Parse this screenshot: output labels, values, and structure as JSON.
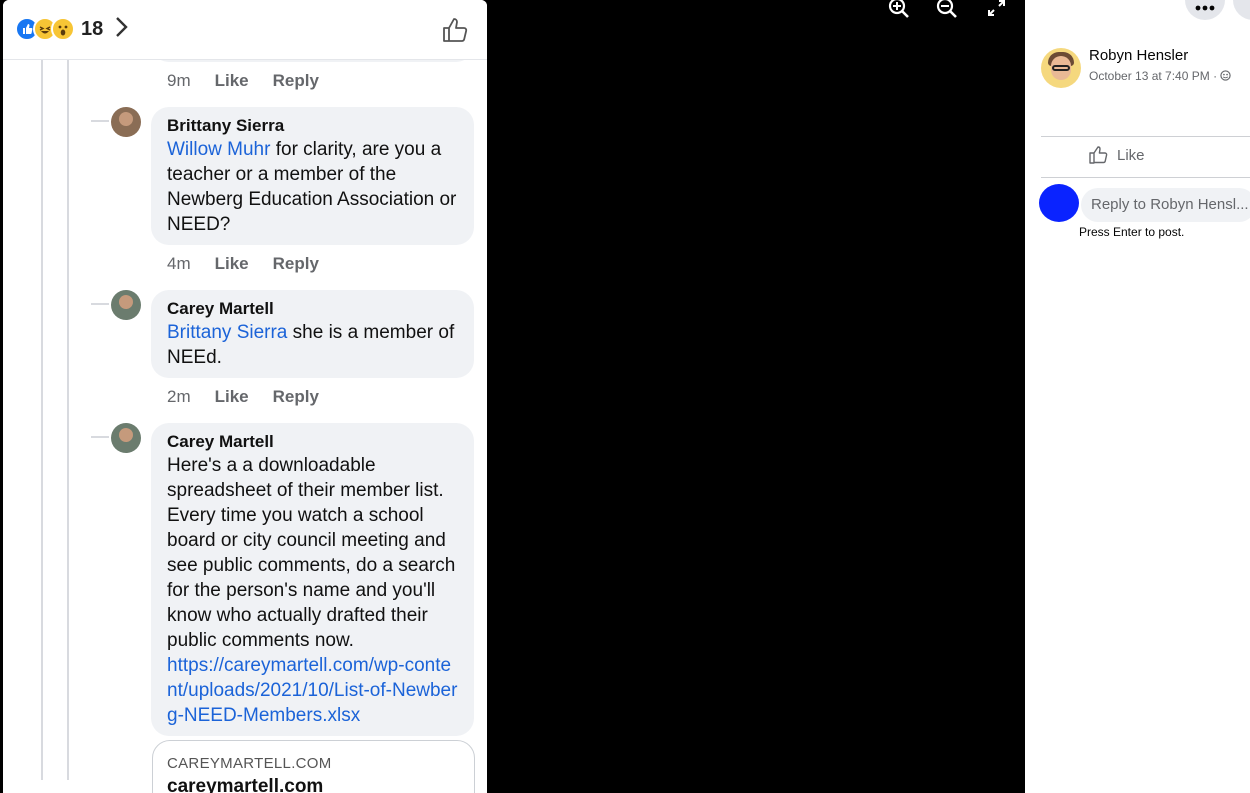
{
  "photo": {
    "reactions": {
      "count": "18",
      "types": [
        "like",
        "haha",
        "wow"
      ]
    },
    "comments": [
      {
        "time": "9m",
        "like": "Like",
        "reply": "Reply"
      },
      {
        "author": "Brittany Sierra",
        "mention": "Willow Muhr",
        "text": " for clarity, are you a teacher or a member of the Newberg Education Association or NEED?",
        "time": "4m",
        "like": "Like",
        "reply": "Reply"
      },
      {
        "author": "Carey Martell",
        "mention": "Brittany Sierra",
        "text": " she is a member of NEEd.",
        "time": "2m",
        "like": "Like",
        "reply": "Reply"
      },
      {
        "author": "Carey Martell",
        "text": "Here's a a downloadable spreadsheet of their member list. Every time you watch a school board or city council meeting and see public comments, do a search for the person's name and you'll know who actually drafted their public comments now.",
        "link": "https://careymartell.com/wp-content/uploads/2021/10/List-of-Newberg-NEED-Members.xlsx"
      }
    ],
    "link_card": {
      "domain": "CAREYMARTELL.COM",
      "title": "careymartell.com"
    }
  },
  "viewer_tools": [
    "zoom-in-icon",
    "zoom-out-icon",
    "fullscreen-icon"
  ],
  "sidebar": {
    "author": "Robyn Hensler",
    "date": "October 13 at 7:40 PM · ",
    "like_label": "Like",
    "reply_placeholder": "Reply to Robyn Hensl...",
    "hint": "Press Enter to post."
  }
}
